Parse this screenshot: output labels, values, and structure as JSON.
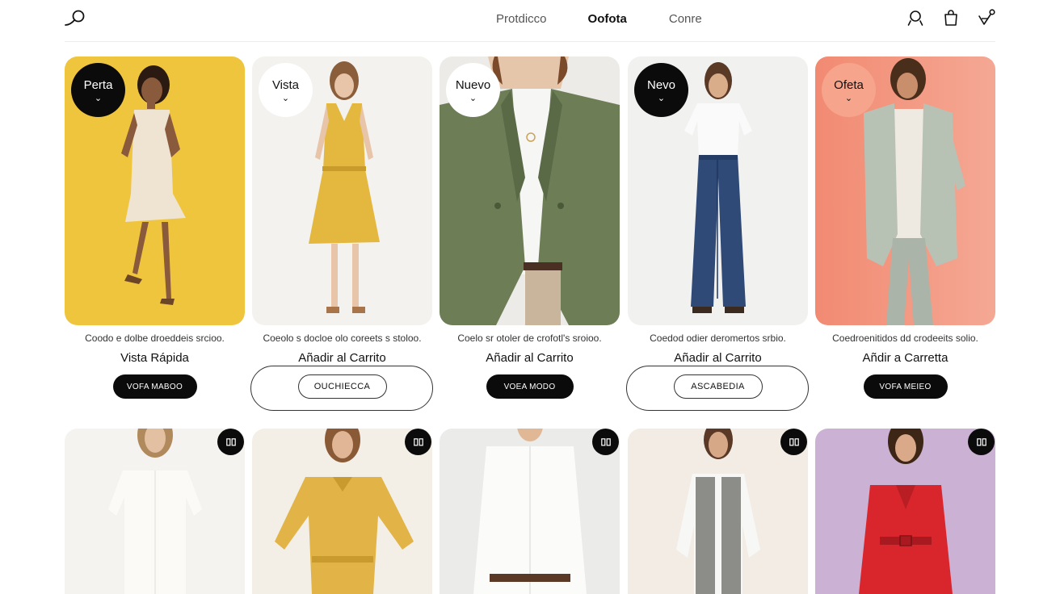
{
  "header": {
    "logo_icon": "magnifier-logo-icon",
    "nav": [
      {
        "label": "Protdicco",
        "active": false
      },
      {
        "label": "Oofota",
        "active": true
      },
      {
        "label": "Conre",
        "active": false
      }
    ],
    "icons": [
      "user-icon",
      "shopping-bag-icon",
      "wishlist-icon"
    ]
  },
  "products_row1": [
    {
      "badge": "Perta",
      "badge_style": "dark",
      "description": "Coodo e dolbe droeddeis srcioo.",
      "action": "Vista Rápida",
      "button": "VOFA MABOO",
      "button_style": "dark"
    },
    {
      "badge": "Vista",
      "badge_style": "light",
      "description": "Coeolo s docloe olo coreets s stoloo.",
      "action": "Añadir al Carrito",
      "button": "OUCHIECCA",
      "button_style": "outline"
    },
    {
      "badge": "Nuevo",
      "badge_style": "light",
      "description": "Coelo sr otoler de crofotl's sroioo.",
      "action": "Añadir al Carrito",
      "button": "VOEA MODO",
      "button_style": "dark"
    },
    {
      "badge": "Nevo",
      "badge_style": "dark",
      "description": "Coedod odier deromertos srbio.",
      "action": "Añadir al Carrito",
      "button": "ASCABEDIA",
      "button_style": "outline"
    },
    {
      "badge": "Ofeta",
      "badge_style": "coral",
      "description": "Coedroenitidos dd crodeeits solio.",
      "action": "Añdir a Carretta",
      "button": "VOFA MEIEO",
      "button_style": "dark"
    }
  ],
  "products_row2_count": 5,
  "colors": {
    "accent": "#0b0b0b",
    "yellow_bg": "#f0c53e",
    "coral_bg": "#f08670",
    "lilac_bg": "#cbb1d4"
  }
}
